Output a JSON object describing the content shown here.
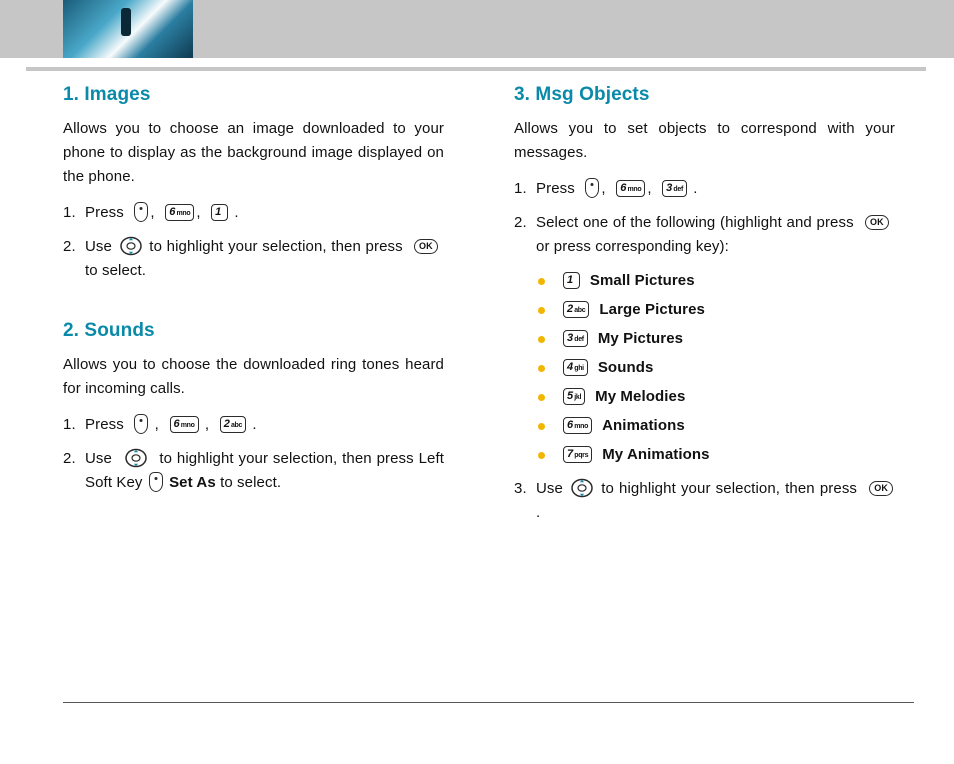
{
  "sections": {
    "images": {
      "title": "1. Images",
      "intro": "Allows you to choose an image downloaded to your phone to display as the background image displayed on the phone.",
      "step1_num": "1.",
      "step1_press": "Press",
      "step2_num": "2.",
      "step2_a": "Use",
      "step2_b": "to highlight your selection, then press",
      "step2_c": "to select."
    },
    "sounds": {
      "title": "2. Sounds",
      "intro": "Allows you to choose the downloaded ring tones heard for incoming calls.",
      "step1_num": "1.",
      "step1_press": "Press",
      "step2_num": "2.",
      "step2_a": "Use",
      "step2_b": "to highlight your selection, then press Left Soft Key",
      "step2_setas": "Set As",
      "step2_c": "to select."
    },
    "msg": {
      "title": "3. Msg Objects",
      "intro": "Allows you to set objects to correspond with your messages.",
      "step1_num": "1.",
      "step1_press": "Press",
      "step2_num": "2.",
      "step2_text": "Select one of the following (highlight and press",
      "step2_tail": "or press corresponding key):",
      "options": [
        {
          "key_big": "1",
          "key_sub": "",
          "label": "Small Pictures"
        },
        {
          "key_big": "2",
          "key_sub": "abc",
          "label": "Large Pictures"
        },
        {
          "key_big": "3",
          "key_sub": "def",
          "label": "My Pictures"
        },
        {
          "key_big": "4",
          "key_sub": "ghi",
          "label": "Sounds"
        },
        {
          "key_big": "5",
          "key_sub": "jkl",
          "label": "My Melodies"
        },
        {
          "key_big": "6",
          "key_sub": "mno",
          "label": "Animations"
        },
        {
          "key_big": "7",
          "key_sub": "pqrs",
          "label": "My Animations"
        }
      ],
      "step3_num": "3.",
      "step3_a": "Use",
      "step3_b": "to highlight your selection, then press"
    }
  },
  "keys": {
    "k6": {
      "big": "6",
      "sub": "mno"
    },
    "k1": {
      "big": "1",
      "sub": ""
    },
    "k2": {
      "big": "2",
      "sub": "abc"
    },
    "k3": {
      "big": "3",
      "sub": "def"
    },
    "ok": "OK",
    "comma": ",",
    "period": "."
  }
}
